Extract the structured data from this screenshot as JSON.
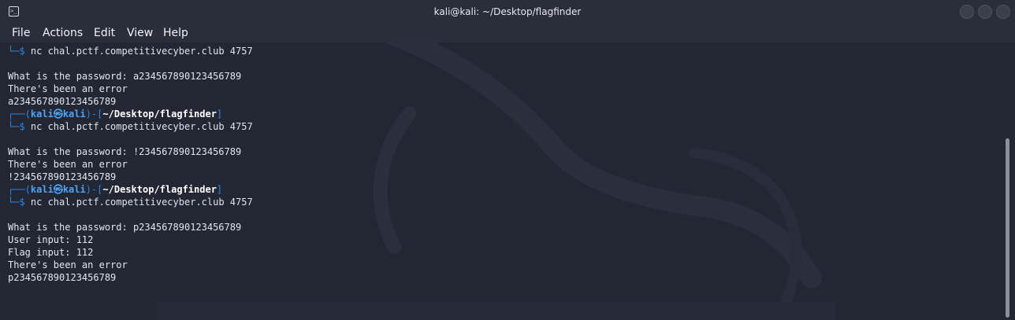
{
  "window": {
    "title": "kali@kali: ~/Desktop/flagfinder",
    "icon": "terminal-icon"
  },
  "menu": {
    "items": [
      "File",
      "Actions",
      "Edit",
      "View",
      "Help"
    ]
  },
  "terminal": {
    "prompt_tail": "└─$",
    "prompt_head": "┌──",
    "user": "kali",
    "at_symbol": "㉿",
    "host": "kali",
    "cwd": "~/Desktop/flagfinder",
    "command": "nc chal.pctf.competitivecyber.club 4757",
    "blocks": [
      {
        "show_header": false,
        "output": [
          "",
          "What is the password: a234567890123456789",
          "There's been an error",
          "a234567890123456789"
        ]
      },
      {
        "show_header": true,
        "output": [
          "",
          "What is the password: !234567890123456789",
          "There's been an error",
          "!234567890123456789"
        ]
      },
      {
        "show_header": true,
        "output": [
          "",
          "What is the password: p234567890123456789",
          "User input: 112",
          "Flag input: 112",
          "There's been an error",
          "p234567890123456789"
        ]
      }
    ]
  },
  "colors": {
    "background": "#232734",
    "titlebar": "#2a2e3a",
    "prompt_blue": "#2e86e6",
    "text": "#e4e6ec"
  }
}
